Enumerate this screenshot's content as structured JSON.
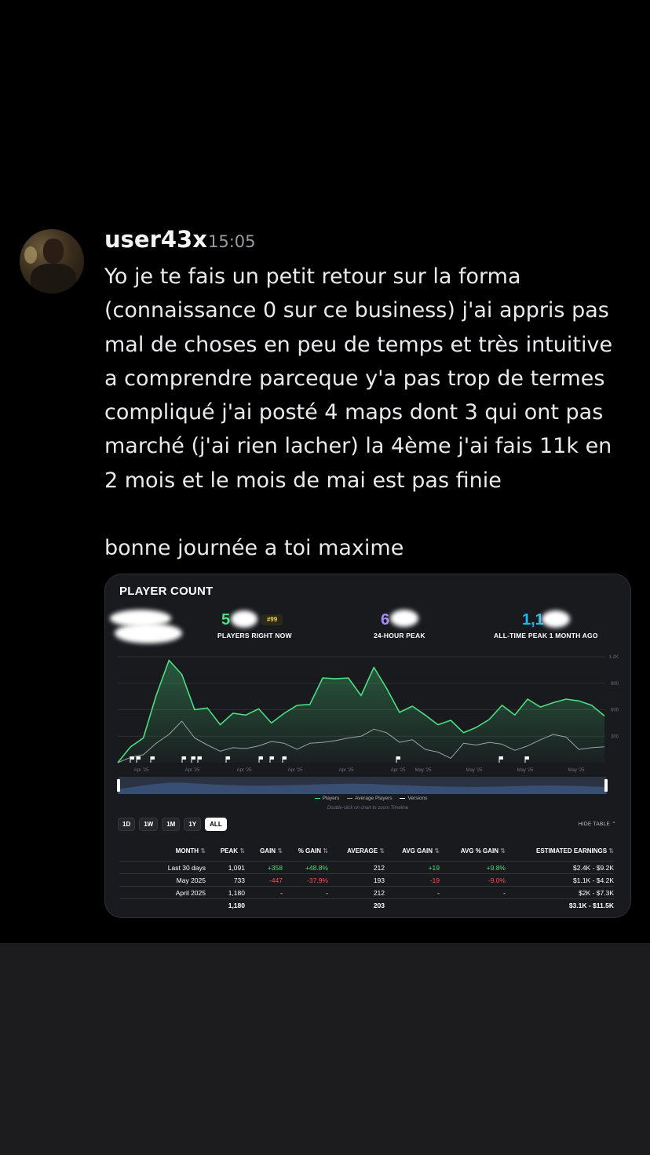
{
  "message": {
    "username": "user43x",
    "timestamp": "15:05",
    "text": "Yo je te fais un petit retour sur la forma (connaissance 0 sur ce business) j'ai appris pas mal de choses en peu de temps et très intuitive a comprendre parceque y'a pas trop de termes compliqué j'ai posté 4 maps dont 3 qui ont pas marché (j'ai rien lacher) la 4ème j'ai fais 11k en 2 mois et le mois de mai est pas finie\n\nbonne journée a toi maxime"
  },
  "card": {
    "title": "PLAYER COUNT",
    "stats": [
      {
        "value_visible": "5",
        "label": "PLAYERS RIGHT NOW",
        "color": "#4ade80"
      },
      {
        "value_visible": "6",
        "label": "24-HOUR PEAK",
        "color": "#a78bfa"
      },
      {
        "value_visible": "1,1",
        "label": "ALL-TIME PEAK 1 MONTH AGO",
        "color": "#22b8f0"
      }
    ],
    "rank_badge": "#99",
    "legend": {
      "players": "Players",
      "average": "Average Players",
      "versions": "Versions"
    },
    "hint": "Double-click on chart to zoom Timeline",
    "ranges": [
      "1D",
      "1W",
      "1M",
      "1Y",
      "ALL"
    ],
    "active_range": "ALL",
    "hide_table": "HIDE TABLE",
    "table": {
      "headers": [
        "MONTH",
        "PEAK",
        "GAIN",
        "% GAIN",
        "AVERAGE",
        "AVG GAIN",
        "AVG % GAIN",
        "ESTIMATED EARNINGS"
      ],
      "rows": [
        [
          "Last 30 days",
          "1,091",
          "+358",
          "+48.8%",
          "212",
          "+19",
          "+9.8%",
          "$2.4K - $9.2K"
        ],
        [
          "May 2025",
          "733",
          "-447",
          "-37.9%",
          "193",
          "-19",
          "-9.0%",
          "$1.1K - $4.2K"
        ],
        [
          "April 2025",
          "1,180",
          "-",
          "-",
          "212",
          "-",
          "-",
          "$2K - $7.3K"
        ]
      ],
      "total": [
        "",
        "1,180",
        "",
        "",
        "203",
        "",
        "",
        "$3.1K - $11.5K"
      ]
    }
  },
  "chart_data": {
    "type": "line",
    "title": "PLAYER COUNT",
    "ylim": [
      0,
      1200
    ],
    "y_ticks": [
      "1.2K",
      "900",
      "600",
      "300"
    ],
    "x_tick_labels": [
      "Apr '25",
      "Apr '25",
      "Apr '25",
      "Apr '25",
      "Apr '25",
      "Apr '25",
      "May '25",
      "May '25",
      "May '25",
      "May '25"
    ],
    "series": [
      {
        "name": "Players",
        "color": "#4ade80",
        "values": [
          0,
          180,
          280,
          760,
          1160,
          1000,
          600,
          620,
          430,
          560,
          540,
          610,
          450,
          560,
          650,
          660,
          960,
          950,
          960,
          760,
          1080,
          840,
          570,
          640,
          540,
          430,
          480,
          340,
          400,
          490,
          650,
          540,
          720,
          630,
          680,
          720,
          700,
          650,
          530
        ]
      },
      {
        "name": "Average Players",
        "color": "#9aa0aa",
        "values": [
          0,
          60,
          90,
          220,
          320,
          470,
          280,
          200,
          130,
          170,
          160,
          190,
          240,
          220,
          150,
          220,
          230,
          250,
          280,
          300,
          380,
          340,
          230,
          260,
          150,
          120,
          50,
          220,
          200,
          230,
          210,
          140,
          190,
          260,
          320,
          290,
          150,
          170,
          180
        ]
      }
    ],
    "version_flags": 14
  },
  "colors": {
    "accent": "#4ade80",
    "positive": "#4ade80",
    "negative": "#f15252"
  }
}
